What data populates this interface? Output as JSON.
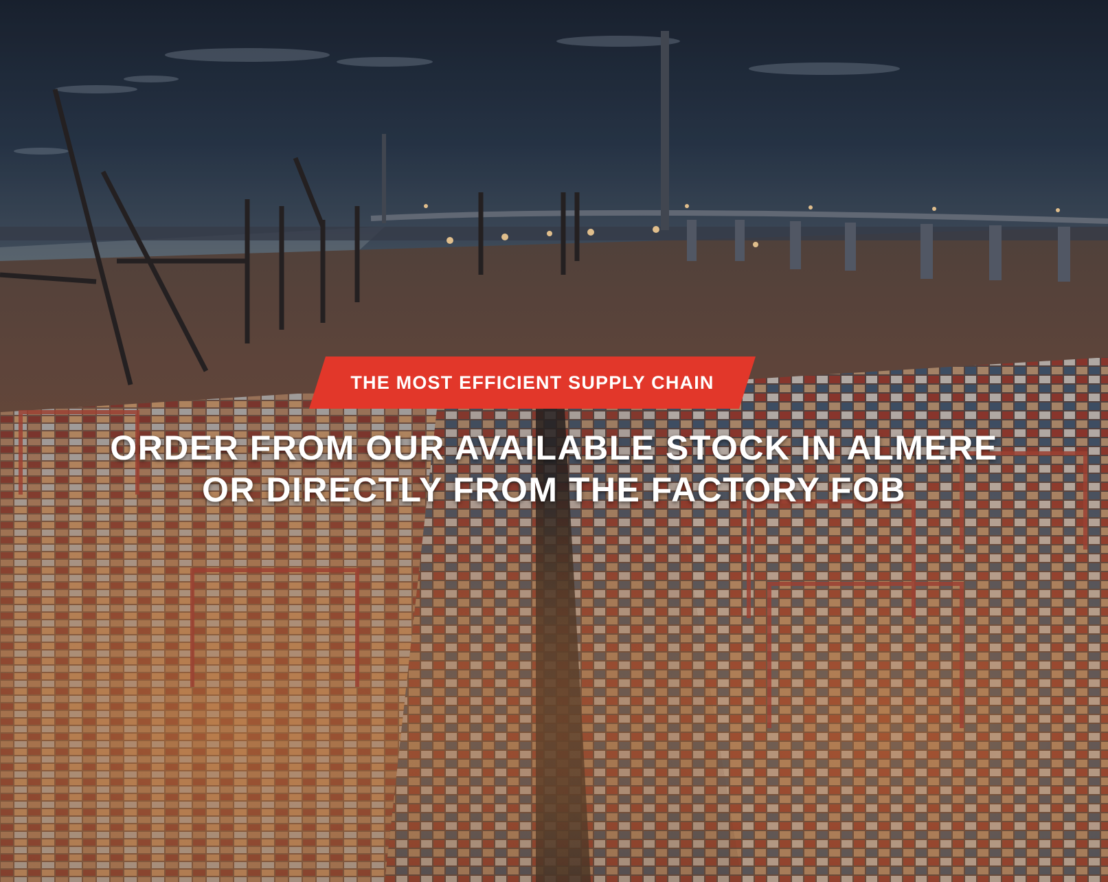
{
  "banner": {
    "tagline": "THE MOST EFFICIENT SUPPLY CHAIN",
    "headline_line1": "ORDER FROM OUR AVAILABLE STOCK IN ALMERE",
    "headline_line2": "OR DIRECTLY FROM THE FACTORY FOB"
  },
  "colors": {
    "accent": "#e2372a",
    "text": "#ffffff",
    "sky": "#1f2a3c",
    "port_glow": "#d9793a"
  }
}
